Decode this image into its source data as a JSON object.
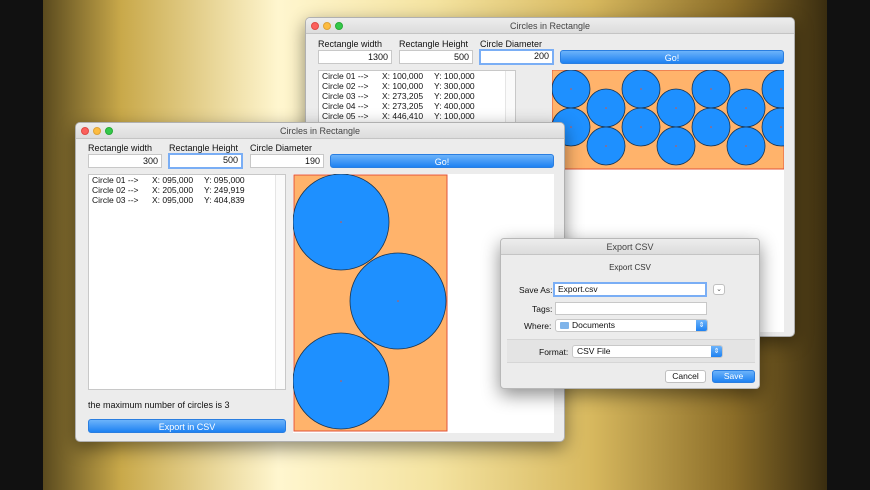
{
  "back_window": {
    "title": "Circles in Rectangle",
    "labels": {
      "width": "Rectangle width",
      "height": "Rectangle Height",
      "diameter": "Circle Diameter"
    },
    "width_value": "1300",
    "height_value": "500",
    "diameter_value": "200",
    "go_label": "Go!",
    "rows": [
      {
        "name": "Circle 01 -->",
        "x": "X: 100,000",
        "y": "Y: 100,000"
      },
      {
        "name": "Circle 02 -->",
        "x": "X: 100,000",
        "y": "Y: 300,000"
      },
      {
        "name": "Circle 03 -->",
        "x": "X: 273,205",
        "y": "Y: 200,000"
      },
      {
        "name": "Circle 04 -->",
        "x": "X: 273,205",
        "y": "Y: 400,000"
      },
      {
        "name": "Circle 05 -->",
        "x": "X: 446,410",
        "y": "Y: 100,000"
      }
    ]
  },
  "front_window": {
    "title": "Circles in Rectangle",
    "labels": {
      "width": "Rectangle width",
      "height": "Rectangle Height",
      "diameter": "Circle Diameter"
    },
    "width_value": "300",
    "height_value": "500",
    "diameter_value": "190",
    "go_label": "Go!",
    "rows": [
      {
        "name": "Circle 01 -->",
        "x": "X: 095,000",
        "y": "Y: 095,000"
      },
      {
        "name": "Circle 02 -->",
        "x": "X: 205,000",
        "y": "Y: 249,919"
      },
      {
        "name": "Circle 03 -->",
        "x": "X: 095,000",
        "y": "Y: 404,839"
      }
    ],
    "result_text": "the maximum number of circles is 3",
    "export_label": "Export in CSV"
  },
  "export_sheet": {
    "title": "Export CSV",
    "subtitle": "Export CSV",
    "save_as_label": "Save As:",
    "save_as_value": "Export.csv",
    "tags_label": "Tags:",
    "where_label": "Where:",
    "where_value": "Documents",
    "format_label": "Format:",
    "format_value": "CSV File",
    "cancel_label": "Cancel",
    "save_label": "Save"
  },
  "colors": {
    "circle_fill": "#1e90ff",
    "rectangle_fill": "#ffb36b",
    "rectangle_border": "#e0533a",
    "accent": "#1e82f2"
  },
  "icons": {
    "window_controls": [
      "close-icon",
      "minimize-icon",
      "zoom-icon"
    ],
    "folder": "folder-icon",
    "disclosure": "chevron-down-icon",
    "popup": "up-down-arrows-icon"
  }
}
